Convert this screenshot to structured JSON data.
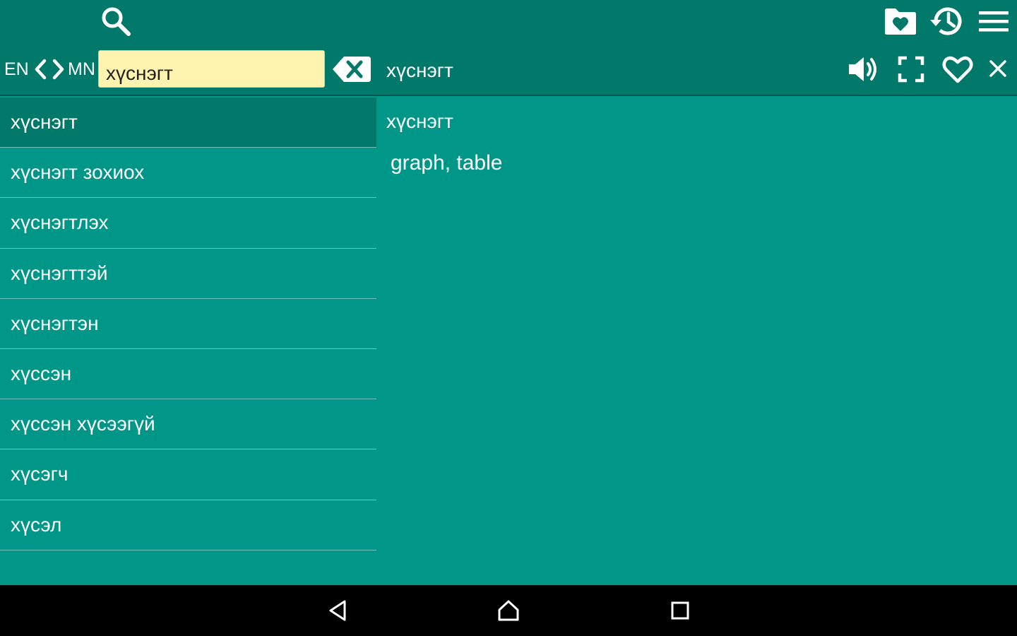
{
  "toolbar": {
    "search_icon": "search-icon",
    "favorites_icon": "favorites-folder-icon",
    "history_icon": "history-icon",
    "menu_icon": "menu-icon"
  },
  "search": {
    "lang_from": "EN",
    "lang_to": "MN",
    "value": "хүснэгт",
    "clear_icon": "backspace-clear-icon"
  },
  "detail_header": {
    "title": "хүснэгт",
    "actions": [
      "speaker-icon",
      "fullscreen-icon",
      "heart-icon",
      "close-icon"
    ]
  },
  "word_list": [
    "хүснэгт",
    "хүснэгт зохиох",
    "хүснэгтлэх",
    "хүснэгттэй",
    "хүснэгтэн",
    "хүссэн",
    "хүссэн хүсээгүй",
    "хүсэгч",
    "хүсэл"
  ],
  "selected_index": 0,
  "detail": {
    "word": "хүснэгт",
    "meaning": "graph, table"
  },
  "navbar": {
    "back_icon": "back-icon",
    "home_icon": "home-icon",
    "recents_icon": "recents-icon"
  },
  "colors": {
    "primary": "#009688",
    "primary_dark": "#00796B",
    "input_bg": "#FFF3B0",
    "nav_bg": "#000000"
  }
}
